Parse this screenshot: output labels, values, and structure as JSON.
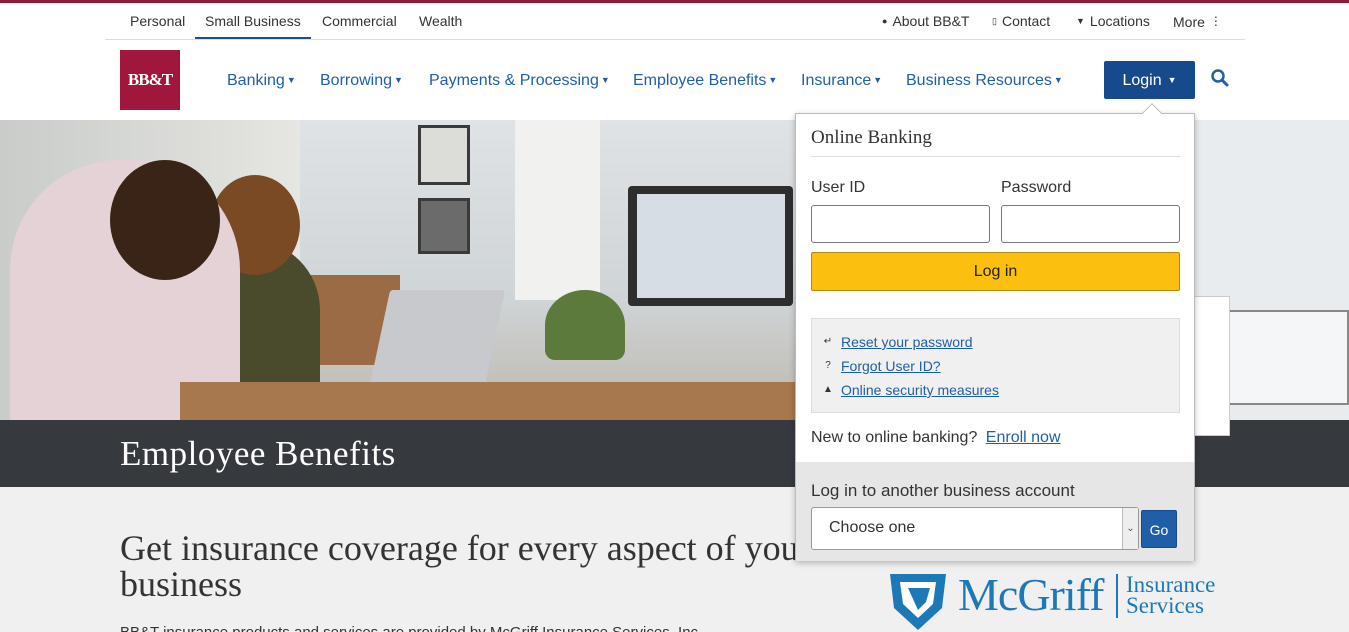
{
  "segments": [
    {
      "label": "Personal",
      "active": false
    },
    {
      "label": "Small Business",
      "active": true
    },
    {
      "label": "Commercial",
      "active": false
    },
    {
      "label": "Wealth",
      "active": false
    }
  ],
  "utility_links": [
    {
      "label": "About BB&T",
      "icon": "person-icon"
    },
    {
      "label": "Contact",
      "icon": "phone-icon"
    },
    {
      "label": "Locations",
      "icon": "map-pin-icon"
    },
    {
      "label": "More",
      "icon": "more-vertical-icon"
    }
  ],
  "logo_text": "BB&T",
  "nav": [
    "Banking",
    "Borrowing",
    "Payments & Processing",
    "Employee Benefits",
    "Insurance",
    "Business Resources"
  ],
  "login_button": "Login",
  "hero": {
    "title": "Employee Benefits"
  },
  "content": {
    "headline": "Get insurance coverage for every aspect of your business",
    "body": "BB&T insurance products and services are provided by McGriff Insurance Services, Inc."
  },
  "partner_logo": {
    "name": "McGriff",
    "tagline_line1": "Insurance",
    "tagline_line2": "Services"
  },
  "popup": {
    "title": "Online Banking",
    "user_id_label": "User ID",
    "password_label": "Password",
    "user_id_value": "",
    "password_value": "",
    "login_button": "Log in",
    "links": [
      {
        "label": "Reset your password",
        "icon": "key-icon"
      },
      {
        "label": "Forgot User ID?",
        "icon": "question-icon"
      },
      {
        "label": "Online security measures",
        "icon": "shield-icon"
      }
    ],
    "new_text": "New to online banking?",
    "enroll_link": "Enroll now",
    "other_account_title": "Log in to another business account",
    "select_value": "Choose one",
    "go_button": "Go"
  },
  "colors": {
    "brand": "#a0163c",
    "link": "#1f5fa8",
    "login_bg": "#174a8c",
    "login_cta": "#fbbf10",
    "band": "#363a3f"
  }
}
